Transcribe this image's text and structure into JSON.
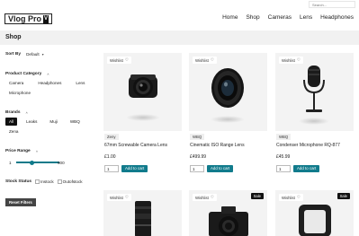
{
  "header": {
    "search_placeholder": "Search...",
    "logo_text": "Vlog Pro",
    "logo_badge": "V",
    "nav": [
      "Home",
      "Shop",
      "Cameras",
      "Lens",
      "Headphones"
    ]
  },
  "breadcrumb": {
    "title": "Shop"
  },
  "sidebar": {
    "sort_label": "Sort By",
    "sort_value": "Default",
    "category_heading": "Product Category",
    "categories": [
      "Camera",
      "Headphones",
      "Lens",
      "Microphone"
    ],
    "brands_heading": "Brands",
    "brands": [
      "All",
      "Leaks",
      "Muji",
      "WBQ",
      "Zena"
    ],
    "active_brand": "All",
    "price_heading": "Price Range",
    "price_min": "1",
    "price_max": "900",
    "price_level_fraction": 0.36,
    "stock_heading": "Stock Status",
    "stock_options": [
      "Instock",
      "Outofstock"
    ],
    "reset_label": "Reset Filters"
  },
  "products": [
    {
      "wishlist": "Wishlist",
      "brand": "Zeny",
      "name": "67mm Screwable Camera Lens",
      "price": "£1.00",
      "qty": "1",
      "cart": "Add to cart",
      "sale": ""
    },
    {
      "wishlist": "Wishlist",
      "brand": "WBQ",
      "name": "Cinematic ISO Range Lens",
      "price": "£499.99",
      "qty": "1",
      "cart": "Add to cart",
      "sale": ""
    },
    {
      "wishlist": "Wishlist",
      "brand": "WBQ",
      "name": "Condenser Microphone RQ-877",
      "price": "£45.99",
      "qty": "1",
      "cart": "Add to cart",
      "sale": ""
    },
    {
      "wishlist": "Wishlist",
      "sale": ""
    },
    {
      "wishlist": "Wishlist",
      "sale": "Sale"
    },
    {
      "wishlist": "Wishlist",
      "sale": "Sale"
    }
  ],
  "colors": {
    "accent": "#117b8c",
    "dark": "#111111",
    "card_bg": "#f3f3f3"
  }
}
